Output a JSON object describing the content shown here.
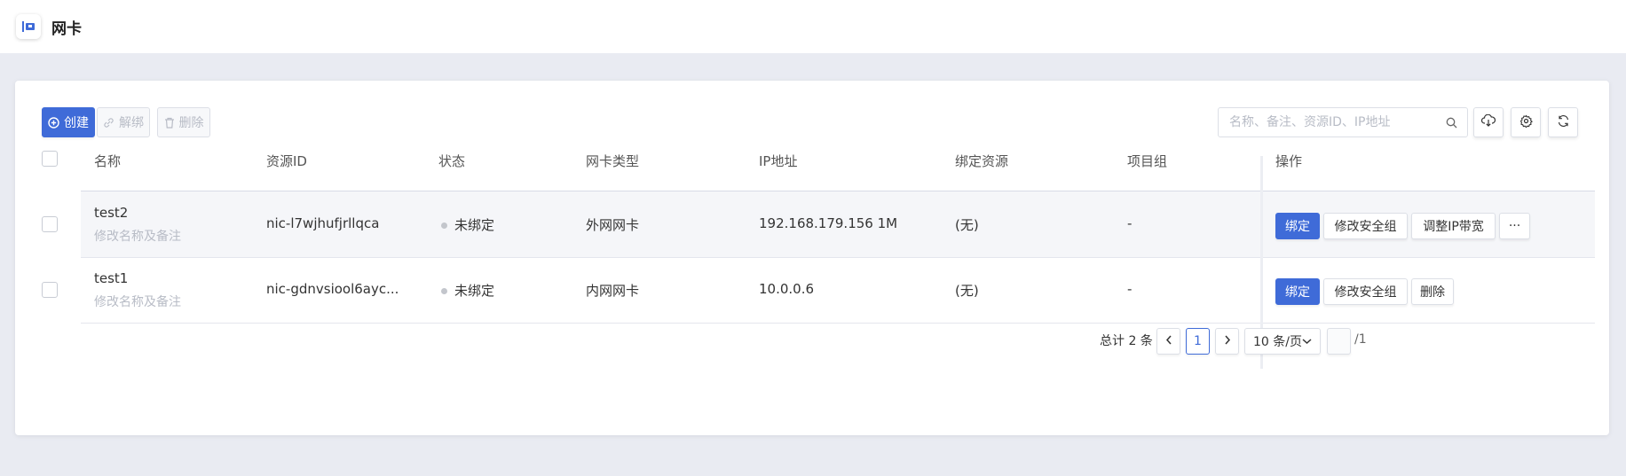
{
  "header": {
    "title": "网卡",
    "icon": "nic-icon"
  },
  "toolbar": {
    "create_label": "创建",
    "unbind_label": "解绑",
    "delete_label": "删除",
    "search_placeholder": "名称、备注、资源ID、IP地址"
  },
  "table": {
    "columns": [
      "名称",
      "资源ID",
      "状态",
      "网卡类型",
      "IP地址",
      "绑定资源",
      "项目组",
      "操作"
    ],
    "rows": [
      {
        "name": "test2",
        "remark": "修改名称及备注",
        "resource_id": "nic-l7wjhufjrllqca",
        "status": "未绑定",
        "type": "外网网卡",
        "ip": "192.168.179.156 1M",
        "bound": "(无)",
        "project": "-",
        "actions": [
          "绑定",
          "修改安全组",
          "调整IP带宽",
          "···"
        ]
      },
      {
        "name": "test1",
        "remark": "修改名称及备注",
        "resource_id": "nic-gdnvsiool6ayc...",
        "status": "未绑定",
        "type": "内网网卡",
        "ip": "10.0.0.6",
        "bound": "(无)",
        "project": "-",
        "actions": [
          "绑定",
          "修改安全组",
          "删除"
        ]
      }
    ]
  },
  "pagination": {
    "total_text": "总计 2 条",
    "current_page": "1",
    "page_size": "10 条/页",
    "total_pages_text": "/1"
  },
  "colors": {
    "primary": "#3f6bd8",
    "background": "#e9ebf2",
    "muted": "#b8bcc6"
  }
}
